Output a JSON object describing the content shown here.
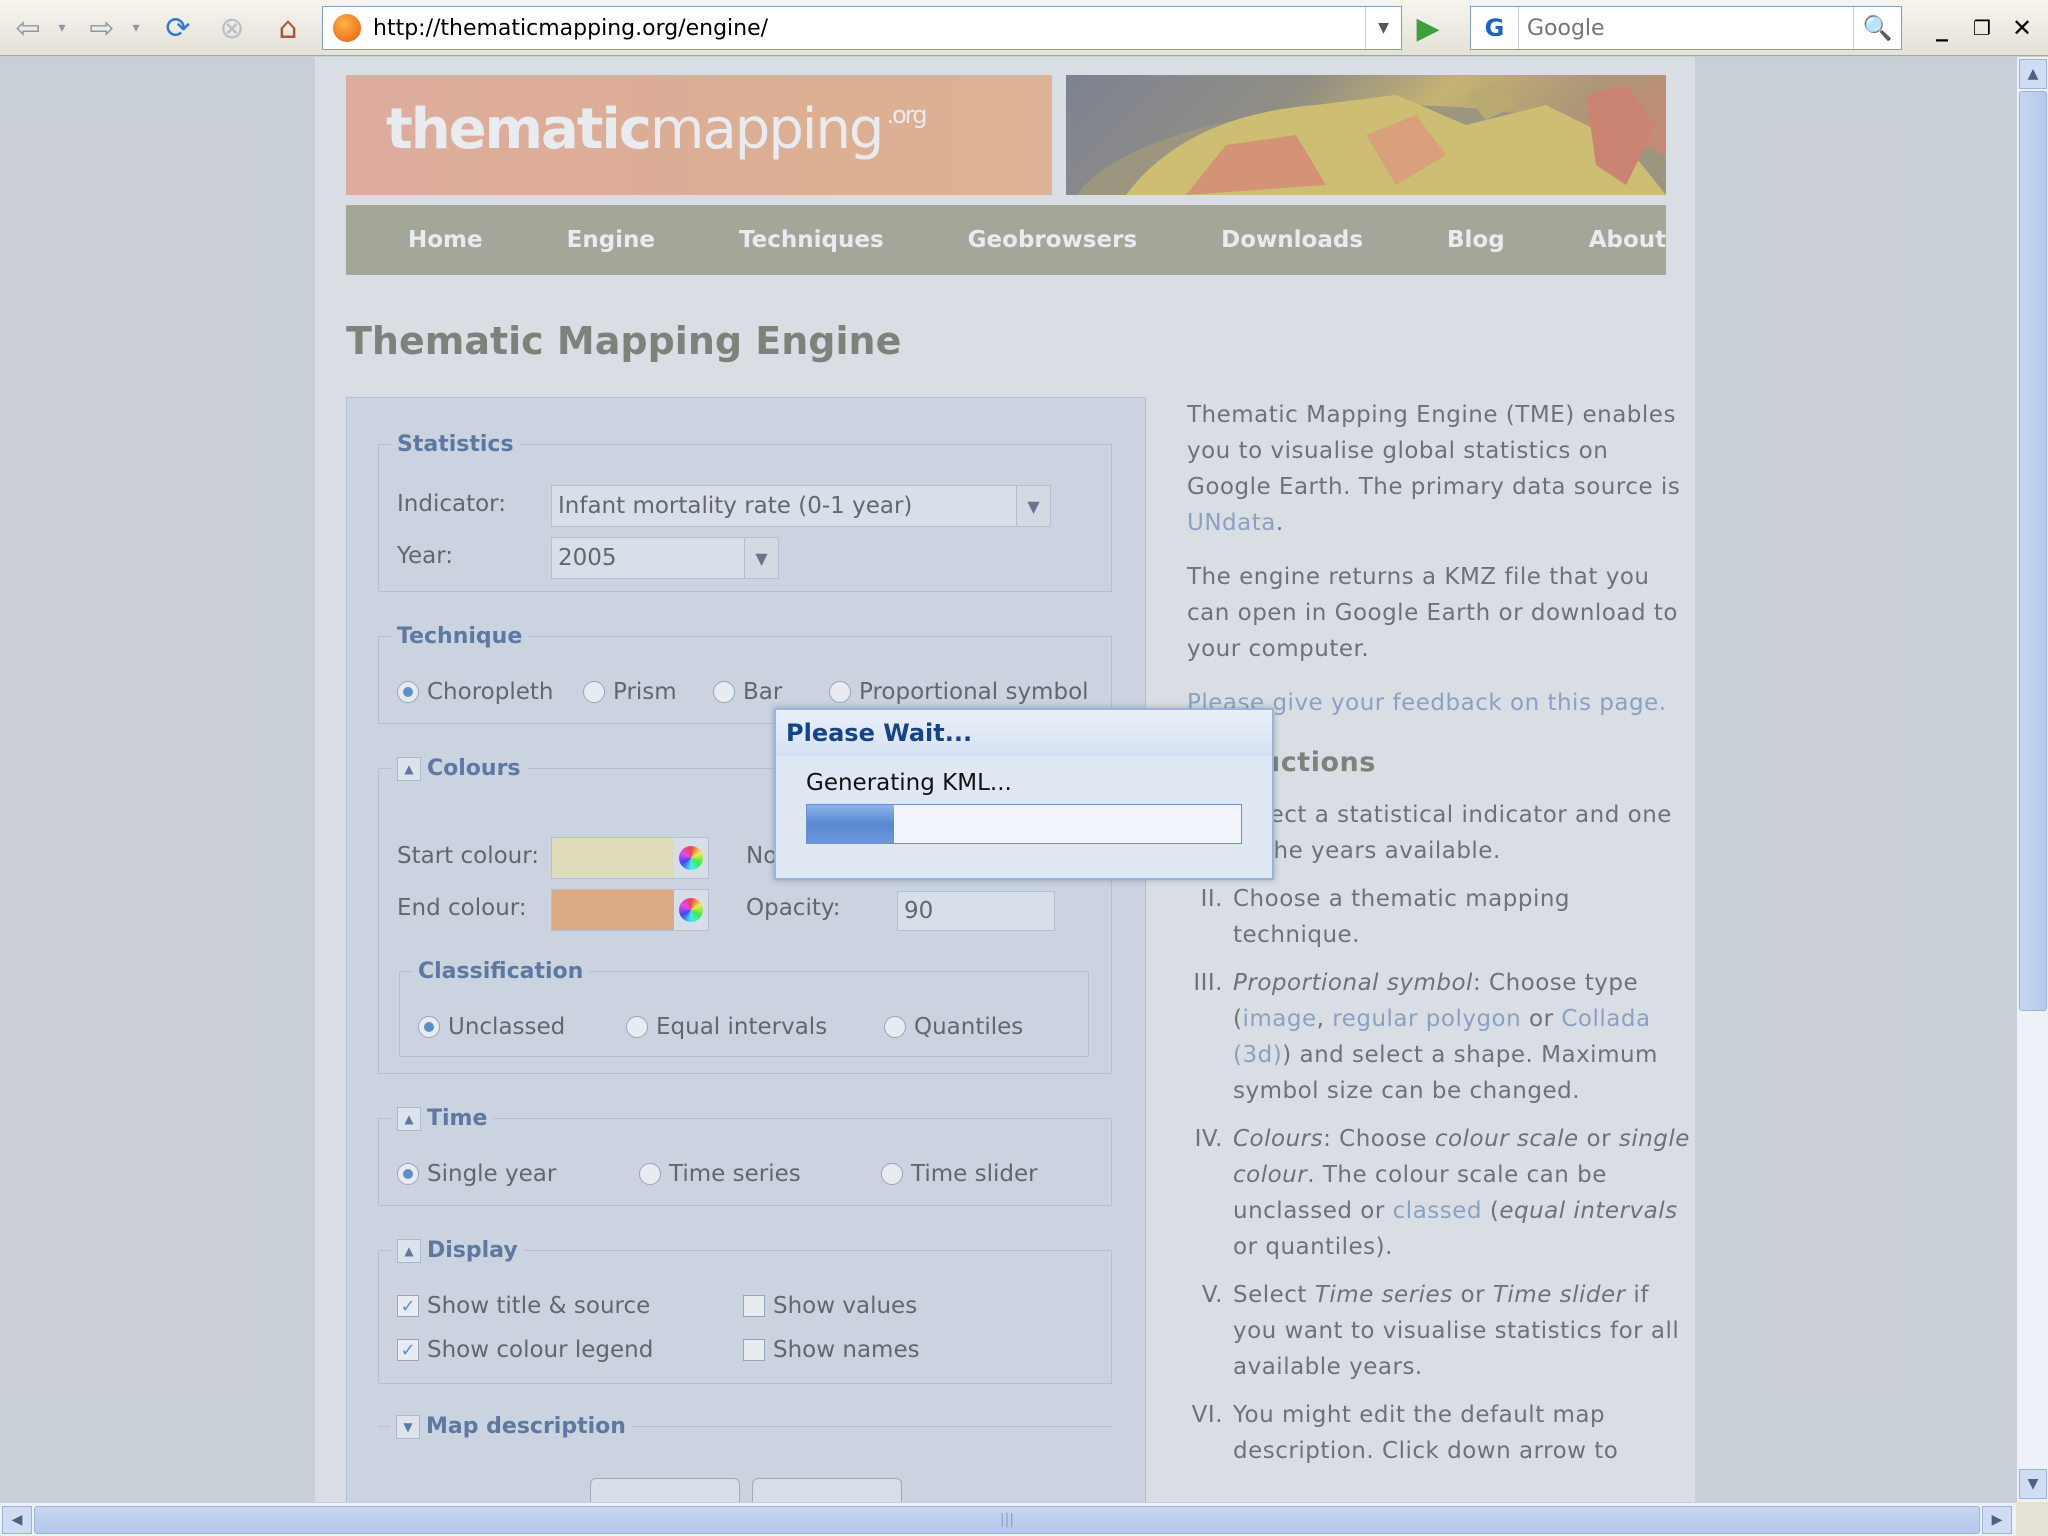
{
  "browser": {
    "url": "http://thematicmapping.org/engine/",
    "search_placeholder": "Google",
    "search_engine_glyph": "G",
    "controls": {
      "back": "back-icon",
      "forward": "forward-icon",
      "reload": "reload-icon",
      "stop": "stop-icon",
      "home": "home-icon",
      "go": "go-icon"
    }
  },
  "site": {
    "logo_bold": "thematic",
    "logo_light": "mapping",
    "logo_tld": ".org",
    "nav": [
      "Home",
      "Engine",
      "Techniques",
      "Geobrowsers",
      "Downloads",
      "Blog",
      "About"
    ],
    "page_title": "Thematic Mapping Engine"
  },
  "form": {
    "statistics": {
      "legend": "Statistics",
      "indicator_label": "Indicator:",
      "indicator_value": "Infant mortality rate (0-1 year)",
      "year_label": "Year:",
      "year_value": "2005"
    },
    "technique": {
      "legend": "Technique",
      "options": [
        "Choropleth",
        "Prism",
        "Bar",
        "Proportional symbol"
      ],
      "selected": "Choropleth"
    },
    "colours": {
      "legend": "Colours",
      "start_label": "Start colour:",
      "start_color": "#f0e6ad",
      "end_label": "End colour:",
      "end_color": "#eb9a5c",
      "no_label": "No",
      "opacity_label": "Opacity:",
      "opacity_value": "90"
    },
    "classification": {
      "legend": "Classification",
      "options": [
        "Unclassed",
        "Equal intervals",
        "Quantiles"
      ],
      "selected": "Unclassed"
    },
    "time": {
      "legend": "Time",
      "options": [
        "Single year",
        "Time series",
        "Time slider"
      ],
      "selected": "Single year"
    },
    "display": {
      "legend": "Display",
      "show_title": "Show title & source",
      "show_title_checked": true,
      "show_values": "Show values",
      "show_values_checked": false,
      "show_legend": "Show colour legend",
      "show_legend_checked": true,
      "show_names": "Show names",
      "show_names_checked": false
    },
    "map_description": {
      "legend": "Map description"
    }
  },
  "info": {
    "p1_a": "Thematic Mapping Engine (TME) enables you to visualise global statistics on Google Earth. The primary data source is ",
    "p1_link": "UNdata",
    "p1_b": ".",
    "p2": "The engine returns a KMZ file that you can open in Google Earth or download to your computer.",
    "feedback": "Please give your feedback on this page.",
    "heading": "Instructions",
    "items": [
      {
        "n": "I.",
        "text": "Select a statistical indicator and one of the years available."
      },
      {
        "n": "II.",
        "text": "Choose a thematic mapping technique."
      },
      {
        "n": "III.",
        "em": "Proportional symbol",
        "a": ": Choose type (",
        "l1": "image",
        ",": ", ",
        "l2": "regular polygon",
        "or": " or ",
        "l3": "Collada (3d)",
        "b": ") and select a shape. Maximum symbol size can be changed."
      },
      {
        "n": "IV.",
        "em": "Colours",
        "a": ": Choose ",
        "em2": "colour scale",
        "or": " or ",
        "em3": "single colour",
        "b": ". The colour scale can be unclassed or ",
        "l1": "classed",
        "c": " (",
        "em4": "equal intervals",
        "d": " or quantiles)."
      },
      {
        "n": "V.",
        "a": "Select ",
        "em": "Time series",
        "or": " or ",
        "em2": "Time slider",
        "b": " if you want to visualise statistics for all available years."
      },
      {
        "n": "VI.",
        "text": "You might edit the default map description. Click down arrow to"
      }
    ]
  },
  "modal": {
    "title": "Please Wait...",
    "message": "Generating KML...",
    "progress": 0.2
  }
}
